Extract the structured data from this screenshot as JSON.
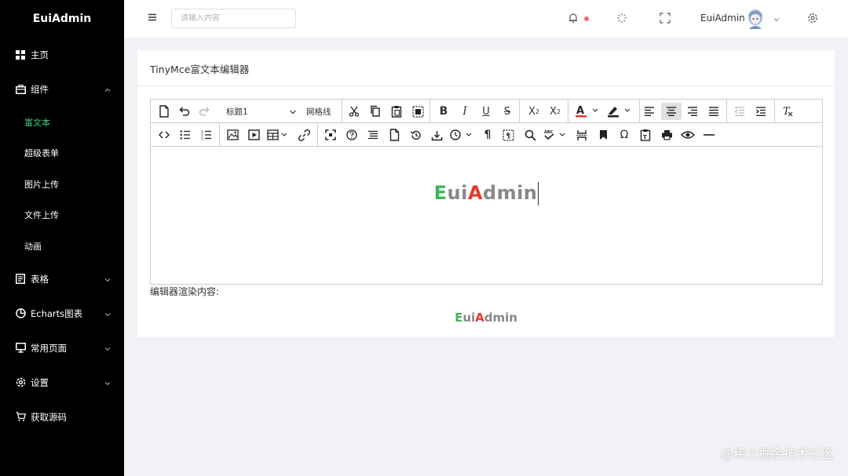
{
  "sidebar": {
    "brand": "EuiAdmin",
    "menu": [
      {
        "label": "主页",
        "icon": "grid-icon"
      },
      {
        "label": "组件",
        "icon": "briefcase-icon",
        "expanded": true,
        "children": [
          {
            "label": "富文本",
            "active": true
          },
          {
            "label": "超级表单"
          },
          {
            "label": "图片上传"
          },
          {
            "label": "文件上传"
          },
          {
            "label": "动画"
          }
        ]
      },
      {
        "label": "表格",
        "icon": "document-icon"
      },
      {
        "label": "Echarts图表",
        "icon": "pie-chart-icon"
      },
      {
        "label": "常用页面",
        "icon": "monitor-icon"
      },
      {
        "label": "设置",
        "icon": "gear-icon"
      },
      {
        "label": "获取源码",
        "icon": "cart-icon"
      }
    ]
  },
  "header": {
    "search_placeholder": "请输入内容",
    "username": "EuiAdmin",
    "notification_dot_color": "#f56c6c"
  },
  "card": {
    "title": "TinyMce富文本编辑器"
  },
  "editor": {
    "heading_select": "标题1",
    "grid_label": "网格线",
    "content_logo": {
      "part1": "E",
      "part2": "ui",
      "part3": "A",
      "part4": "dmin"
    }
  },
  "render": {
    "label": "编辑器渲染内容:",
    "logo": {
      "part1": "E",
      "part2": "ui",
      "part3": "A",
      "part4": "dmin"
    }
  },
  "colors": {
    "active_menu": "#42d17b",
    "logo_green": "#3fb55c",
    "logo_red": "#e23b2c",
    "logo_gray": "#888888"
  },
  "watermark": "@稀土掘金技术社区"
}
